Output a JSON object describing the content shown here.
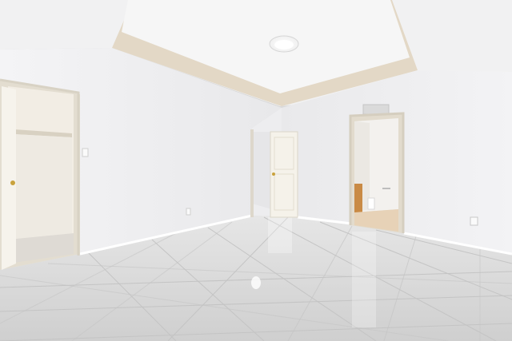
{
  "scene": {
    "subject": "empty-room-interior",
    "colors": {
      "ceiling": "#f2f2f2",
      "tray_band": "#e2d6c2",
      "tray_inner": "#f5f5f5",
      "wall_left": "#f0f0f2",
      "wall_right": "#ececee",
      "wall_back": "#f2f2f3",
      "floor": "#dcdcdc",
      "door": "#f4f1ea",
      "door_frame": "#ddd7cb",
      "grout": "#c6c6c6",
      "bath_floor": "#e7d2b7",
      "cabinet": "#c98a45"
    }
  }
}
